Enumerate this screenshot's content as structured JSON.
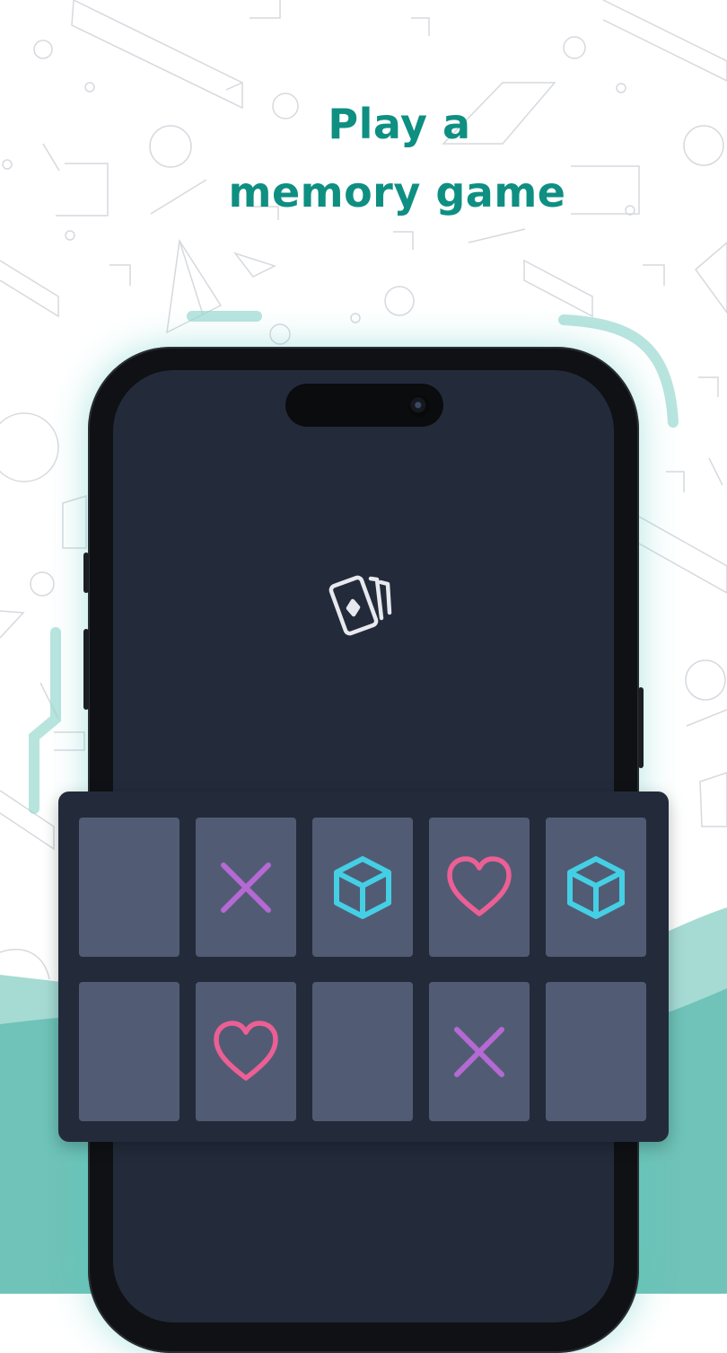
{
  "headline": {
    "line1": "Play a",
    "line2": "memory game"
  },
  "colors": {
    "headline": "#0e8f82",
    "teal_wave": "#6fc3b8",
    "screen": "#232b3b",
    "card": "#515c74",
    "cross": "#b569d3",
    "cube": "#45cfe4",
    "heart": "#ec5f95"
  },
  "board": {
    "rows": [
      [
        {
          "symbol": "none"
        },
        {
          "symbol": "cross-icon"
        },
        {
          "symbol": "cube-icon"
        },
        {
          "symbol": "heart-icon"
        },
        {
          "symbol": "cube-icon"
        }
      ],
      [
        {
          "symbol": "none"
        },
        {
          "symbol": "heart-icon"
        },
        {
          "symbol": "none"
        },
        {
          "symbol": "cross-icon"
        },
        {
          "symbol": "none"
        }
      ]
    ]
  },
  "app_icon": "playing-cards-icon"
}
